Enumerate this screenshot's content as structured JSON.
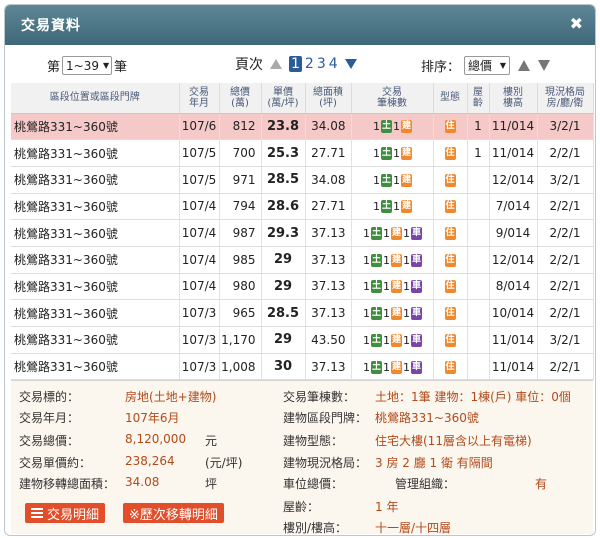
{
  "window": {
    "title": "交易資料",
    "close_glyph": "✖"
  },
  "controls": {
    "page_size_prefix": "第",
    "page_size_value": "1~39",
    "page_size_suffix": "筆",
    "pager_label": "頁次",
    "pages": [
      "1",
      "2",
      "3",
      "4"
    ],
    "current_page": "1",
    "sort_label": "排序：",
    "sort_value": "總價"
  },
  "table": {
    "headers": [
      "區段位置或區段門牌",
      "交易\n年月",
      "總價\n(萬)",
      "單價\n(萬/坪)",
      "總面積\n(坪)",
      "交易\n筆棟數",
      "型態",
      "屋\n齡",
      "樓別\n樓高",
      "現況格局\n房/廳/衛"
    ],
    "rows": [
      {
        "addr": "桃鶯路331~360號",
        "date": "107/6",
        "price": "812",
        "unit": "23.8",
        "area": "34.08",
        "land": "1",
        "land_icon": "土",
        "bldg": "1",
        "bldg_icon": "建",
        "car": "",
        "car_icon": "",
        "type_icon": "住",
        "age": "1",
        "floor": "11/014",
        "layout": "3/2/1"
      },
      {
        "addr": "桃鶯路331~360號",
        "date": "107/5",
        "price": "700",
        "unit": "25.3",
        "area": "27.71",
        "land": "1",
        "land_icon": "土",
        "bldg": "1",
        "bldg_icon": "建",
        "car": "",
        "car_icon": "",
        "type_icon": "住",
        "age": "1",
        "floor": "11/014",
        "layout": "2/2/1"
      },
      {
        "addr": "桃鶯路331~360號",
        "date": "107/5",
        "price": "971",
        "unit": "28.5",
        "area": "34.08",
        "land": "1",
        "land_icon": "土",
        "bldg": "1",
        "bldg_icon": "建",
        "car": "",
        "car_icon": "",
        "type_icon": "住",
        "age": "",
        "floor": "12/014",
        "layout": "3/2/1"
      },
      {
        "addr": "桃鶯路331~360號",
        "date": "107/4",
        "price": "794",
        "unit": "28.6",
        "area": "27.71",
        "land": "1",
        "land_icon": "土",
        "bldg": "1",
        "bldg_icon": "建",
        "car": "",
        "car_icon": "",
        "type_icon": "住",
        "age": "",
        "floor": "7/014",
        "layout": "2/2/1"
      },
      {
        "addr": "桃鶯路331~360號",
        "date": "107/4",
        "price": "987",
        "unit": "29.3",
        "area": "37.13",
        "land": "1",
        "land_icon": "土",
        "bldg": "1",
        "bldg_icon": "建",
        "car": "1",
        "car_icon": "車",
        "type_icon": "住",
        "age": "",
        "floor": "9/014",
        "layout": "2/2/1"
      },
      {
        "addr": "桃鶯路331~360號",
        "date": "107/4",
        "price": "985",
        "unit": "29",
        "area": "37.13",
        "land": "1",
        "land_icon": "土",
        "bldg": "1",
        "bldg_icon": "建",
        "car": "1",
        "car_icon": "車",
        "type_icon": "住",
        "age": "",
        "floor": "12/014",
        "layout": "2/2/1"
      },
      {
        "addr": "桃鶯路331~360號",
        "date": "107/4",
        "price": "980",
        "unit": "29",
        "area": "37.13",
        "land": "1",
        "land_icon": "土",
        "bldg": "1",
        "bldg_icon": "建",
        "car": "1",
        "car_icon": "車",
        "type_icon": "住",
        "age": "",
        "floor": "8/014",
        "layout": "2/2/1"
      },
      {
        "addr": "桃鶯路331~360號",
        "date": "107/3",
        "price": "965",
        "unit": "28.5",
        "area": "37.13",
        "land": "1",
        "land_icon": "土",
        "bldg": "1",
        "bldg_icon": "建",
        "car": "1",
        "car_icon": "車",
        "type_icon": "住",
        "age": "",
        "floor": "10/014",
        "layout": "2/2/1"
      },
      {
        "addr": "桃鶯路331~360號",
        "date": "107/3",
        "price": "1,170",
        "unit": "29",
        "area": "43.50",
        "land": "1",
        "land_icon": "土",
        "bldg": "1",
        "bldg_icon": "建",
        "car": "1",
        "car_icon": "車",
        "type_icon": "住",
        "age": "",
        "floor": "11/014",
        "layout": "3/2/1"
      },
      {
        "addr": "桃鶯路331~360號",
        "date": "107/3",
        "price": "1,008",
        "unit": "30",
        "area": "37.13",
        "land": "1",
        "land_icon": "土",
        "bldg": "1",
        "bldg_icon": "建",
        "car": "1",
        "car_icon": "車",
        "type_icon": "住",
        "age": "",
        "floor": "11/014",
        "layout": "2/2/1"
      }
    ]
  },
  "details": {
    "left": [
      {
        "label": "交易標的：",
        "value": "房地(土地+建物)",
        "unit": ""
      },
      {
        "label": "交易年月：",
        "value": "107年6月",
        "unit": ""
      },
      {
        "label": "交易總價：",
        "value": "8,120,000",
        "unit": "元"
      },
      {
        "label": "交易單價約：",
        "value": "238,264",
        "unit": "(元/坪)"
      },
      {
        "label": "建物移轉總面積：",
        "value": "34.08",
        "unit": "坪"
      }
    ],
    "right": [
      {
        "label": "交易筆棟數：",
        "value": "土地：1筆 建物：1棟(戶) 車位：0個"
      },
      {
        "label": "建物區段門牌：",
        "value": "桃鶯路331~360號"
      },
      {
        "label": "建物型態：",
        "value": "住宅大樓(11層含以上有電梯)"
      },
      {
        "label": "建物現況格局：",
        "value": "3 房 2 廳 1 衛 有隔間"
      },
      {
        "label": "車位總價：",
        "value": ""
      },
      {
        "label": "屋齡：",
        "value": "1 年"
      },
      {
        "label": "樓別/樓高：",
        "value": "十一層/十四層"
      }
    ],
    "mgmt_label": "管理組織：",
    "mgmt_value": "有",
    "btn_detail": "交易明細",
    "btn_history": "※歷次移轉明細"
  }
}
